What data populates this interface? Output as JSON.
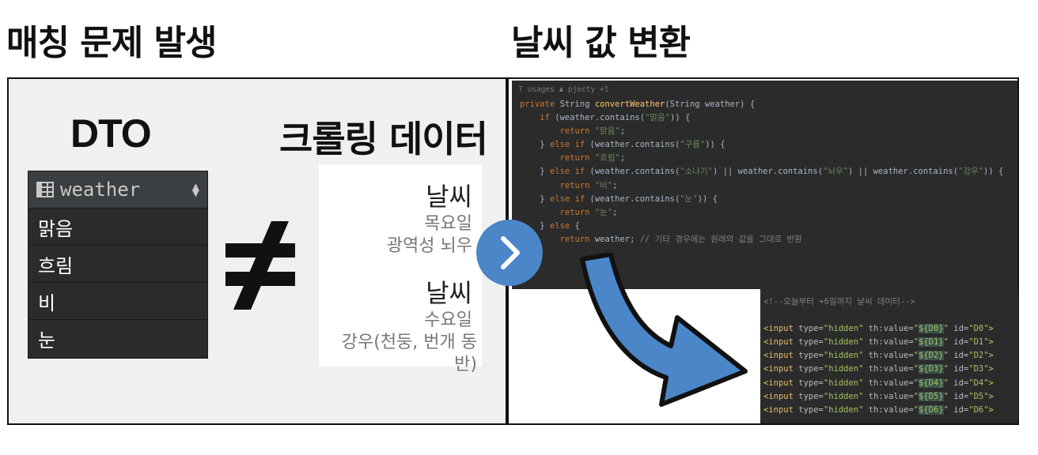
{
  "titles": {
    "left": "매칭 문제 발생",
    "right": "날씨 값 변환"
  },
  "left": {
    "dto_label": "DTO",
    "crawl_label": "크롤링 데이터",
    "table": {
      "column": "weather",
      "rows": [
        "맑음",
        "흐림",
        "비",
        "눈"
      ]
    },
    "card": [
      {
        "title": "날씨",
        "day": "목요일",
        "desc": "광역성 뇌우"
      },
      {
        "title": "날씨",
        "day": "수요일",
        "desc": "강우(천둥, 번개 동반)"
      }
    ]
  },
  "code": {
    "meta": "7 usages  ♟ pjecty +1",
    "lines": [
      "private String convertWeather(String weather) {",
      "    if (weather.contains(\"맑음\")) {",
      "        return \"맑음\";",
      "    } else if (weather.contains(\"구름\")) {",
      "        return \"흐림\";",
      "    } else if (weather.contains(\"소나기\") || weather.contains(\"뇌우\") || weather.contains(\"강우\")) {",
      "        return \"비\";",
      "    } else if (weather.contains(\"눈\")) {",
      "        return \"눈\";",
      "    } else {",
      "        return weather; // 기타 경우에는 원래의 값을 그대로 반환"
    ]
  },
  "html_code": {
    "comment": "<!--오늘부터 +6일까지 날씨 데이터-->",
    "inputs": [
      {
        "expr": "${D0}",
        "id": "D0"
      },
      {
        "expr": "${D1}",
        "id": "D1"
      },
      {
        "expr": "${D2}",
        "id": "D2"
      },
      {
        "expr": "${D3}",
        "id": "D3"
      },
      {
        "expr": "${D4}",
        "id": "D4"
      },
      {
        "expr": "${D5}",
        "id": "D5"
      },
      {
        "expr": "${D6}",
        "id": "D6"
      }
    ]
  },
  "colors": {
    "accent_blue": "#4a86c8",
    "editor_bg": "#2b2b2b"
  },
  "icons": {
    "table": "table-icon",
    "sort": "sort-icon",
    "next": "chevron-right-icon",
    "curved_arrow": "curved-arrow-icon",
    "not_equal": "not-equal-icon"
  }
}
